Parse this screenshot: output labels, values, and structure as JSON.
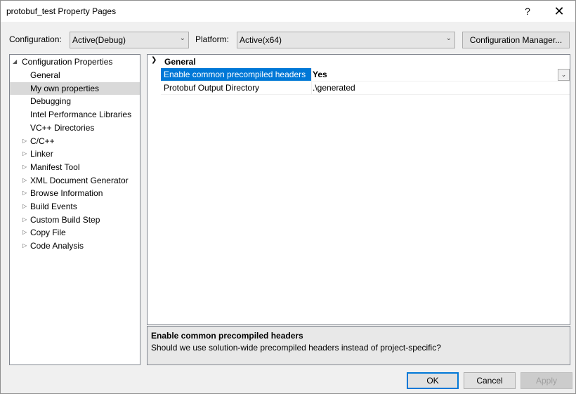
{
  "window": {
    "title": "protobuf_test Property Pages",
    "help_glyph": "?",
    "close_glyph": "✕"
  },
  "toolbar": {
    "configuration_label": "Configuration:",
    "configuration_value": "Active(Debug)",
    "platform_label": "Platform:",
    "platform_value": "Active(x64)",
    "config_manager_label": "Configuration Manager..."
  },
  "tree": {
    "root_label": "Configuration Properties",
    "items": [
      {
        "label": "General",
        "expandable": false
      },
      {
        "label": "My own properties",
        "expandable": false,
        "selected": true
      },
      {
        "label": "Debugging",
        "expandable": false
      },
      {
        "label": "Intel Performance Libraries",
        "expandable": false
      },
      {
        "label": "VC++ Directories",
        "expandable": false
      },
      {
        "label": "C/C++",
        "expandable": true
      },
      {
        "label": "Linker",
        "expandable": true
      },
      {
        "label": "Manifest Tool",
        "expandable": true
      },
      {
        "label": "XML Document Generator",
        "expandable": true
      },
      {
        "label": "Browse Information",
        "expandable": true
      },
      {
        "label": "Build Events",
        "expandable": true
      },
      {
        "label": "Custom Build Step",
        "expandable": true
      },
      {
        "label": "Copy File",
        "expandable": true
      },
      {
        "label": "Code Analysis",
        "expandable": true
      }
    ]
  },
  "grid": {
    "category": "General",
    "properties": [
      {
        "name": "Enable common precompiled headers",
        "value": "Yes",
        "selected": true
      },
      {
        "name": "Protobuf Output Directory",
        "value": ".\\generated",
        "selected": false
      }
    ]
  },
  "description": {
    "title": "Enable common precompiled headers",
    "body": "Should we use solution-wide precompiled headers instead of project-specific?"
  },
  "buttons": {
    "ok": "OK",
    "cancel": "Cancel",
    "apply": "Apply"
  },
  "colors": {
    "selection_blue": "#0078d7",
    "dialog_bg": "#f0f0f0"
  }
}
